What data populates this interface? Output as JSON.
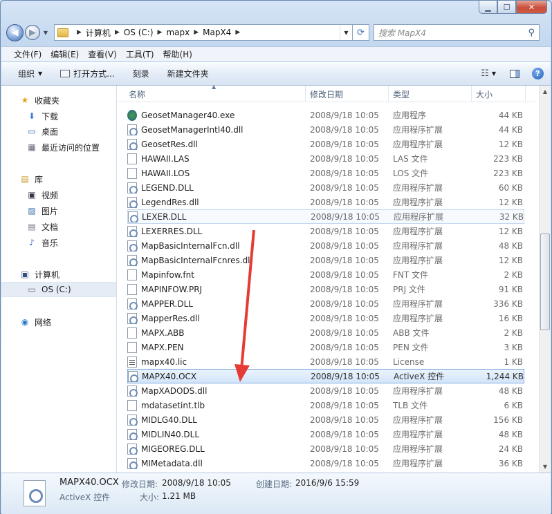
{
  "window": {
    "caption_buttons": {
      "minimize": "▁",
      "maximize": "☐",
      "close": "✕"
    }
  },
  "nav": {
    "back_icon": "back-arrow-icon",
    "forward_icon": "forward-arrow-icon",
    "breadcrumb": [
      "计算机",
      "OS (C:)",
      "mapx",
      "MapX4"
    ],
    "search_placeholder": "搜索 MapX4"
  },
  "menu": [
    "文件(F)",
    "编辑(E)",
    "查看(V)",
    "工具(T)",
    "帮助(H)"
  ],
  "toolbar": {
    "organize": "组织",
    "open_with": "打开方式...",
    "burn": "刻录",
    "new_folder": "新建文件夹"
  },
  "sidebar": [
    {
      "label": "收藏夹",
      "icon": "star-icon",
      "indent": 0
    },
    {
      "label": "下载",
      "icon": "download-folder-icon",
      "indent": 1
    },
    {
      "label": "桌面",
      "icon": "desktop-icon",
      "indent": 1
    },
    {
      "label": "最近访问的位置",
      "icon": "recent-places-icon",
      "indent": 1
    },
    {
      "label": "库",
      "icon": "library-icon",
      "indent": 0
    },
    {
      "label": "视频",
      "icon": "video-icon",
      "indent": 1
    },
    {
      "label": "图片",
      "icon": "pictures-icon",
      "indent": 1
    },
    {
      "label": "文档",
      "icon": "documents-icon",
      "indent": 1
    },
    {
      "label": "音乐",
      "icon": "music-icon",
      "indent": 1
    },
    {
      "label": "计算机",
      "icon": "computer-icon",
      "indent": 0
    },
    {
      "label": "OS (C:)",
      "icon": "drive-icon",
      "indent": 1,
      "selected": true
    },
    {
      "label": "网络",
      "icon": "network-icon",
      "indent": 0
    }
  ],
  "columns": {
    "name": "名称",
    "date": "修改日期",
    "type": "类型",
    "size": "大小"
  },
  "files": [
    {
      "name": "GeosetManager40.exe",
      "date": "2008/9/18 10:05",
      "type": "应用程序",
      "size": "44 KB",
      "icon": "exe"
    },
    {
      "name": "GeosetManagerIntl40.dll",
      "date": "2008/9/18 10:05",
      "type": "应用程序扩展",
      "size": "44 KB",
      "icon": "dll"
    },
    {
      "name": "GeosetRes.dll",
      "date": "2008/9/18 10:05",
      "type": "应用程序扩展",
      "size": "12 KB",
      "icon": "dll"
    },
    {
      "name": "HAWAII.LAS",
      "date": "2008/9/18 10:05",
      "type": "LAS 文件",
      "size": "223 KB",
      "icon": "blank"
    },
    {
      "name": "HAWAII.LOS",
      "date": "2008/9/18 10:05",
      "type": "LOS 文件",
      "size": "223 KB",
      "icon": "blank"
    },
    {
      "name": "LEGEND.DLL",
      "date": "2008/9/18 10:05",
      "type": "应用程序扩展",
      "size": "60 KB",
      "icon": "dll"
    },
    {
      "name": "LegendRes.dll",
      "date": "2008/9/18 10:05",
      "type": "应用程序扩展",
      "size": "12 KB",
      "icon": "dll"
    },
    {
      "name": "LEXER.DLL",
      "date": "2008/9/18 10:05",
      "type": "应用程序扩展",
      "size": "32 KB",
      "icon": "dll",
      "state": "hover"
    },
    {
      "name": "LEXERRES.DLL",
      "date": "2008/9/18 10:05",
      "type": "应用程序扩展",
      "size": "12 KB",
      "icon": "dll"
    },
    {
      "name": "MapBasicInternalFcn.dll",
      "date": "2008/9/18 10:05",
      "type": "应用程序扩展",
      "size": "48 KB",
      "icon": "dll"
    },
    {
      "name": "MapBasicInternalFcnres.dll",
      "date": "2008/9/18 10:05",
      "type": "应用程序扩展",
      "size": "12 KB",
      "icon": "dll"
    },
    {
      "name": "Mapinfow.fnt",
      "date": "2008/9/18 10:05",
      "type": "FNT 文件",
      "size": "2 KB",
      "icon": "blank"
    },
    {
      "name": "MAPINFOW.PRJ",
      "date": "2008/9/18 10:05",
      "type": "PRJ 文件",
      "size": "91 KB",
      "icon": "blank"
    },
    {
      "name": "MAPPER.DLL",
      "date": "2008/9/18 10:05",
      "type": "应用程序扩展",
      "size": "336 KB",
      "icon": "dll"
    },
    {
      "name": "MapperRes.dll",
      "date": "2008/9/18 10:05",
      "type": "应用程序扩展",
      "size": "16 KB",
      "icon": "dll"
    },
    {
      "name": "MAPX.ABB",
      "date": "2008/9/18 10:05",
      "type": "ABB 文件",
      "size": "2 KB",
      "icon": "blank"
    },
    {
      "name": "MAPX.PEN",
      "date": "2008/9/18 10:05",
      "type": "PEN 文件",
      "size": "3 KB",
      "icon": "blank"
    },
    {
      "name": "mapx40.lic",
      "date": "2008/9/18 10:05",
      "type": "License",
      "size": "1 KB",
      "icon": "doc"
    },
    {
      "name": "MAPX40.OCX",
      "date": "2008/9/18 10:05",
      "type": "ActiveX 控件",
      "size": "1,244 KB",
      "icon": "dll",
      "state": "selected"
    },
    {
      "name": "MapXADODS.dll",
      "date": "2008/9/18 10:05",
      "type": "应用程序扩展",
      "size": "48 KB",
      "icon": "dll"
    },
    {
      "name": "mdatasetint.tlb",
      "date": "2008/9/18 10:05",
      "type": "TLB 文件",
      "size": "6 KB",
      "icon": "blank"
    },
    {
      "name": "MIDLG40.DLL",
      "date": "2008/9/18 10:05",
      "type": "应用程序扩展",
      "size": "156 KB",
      "icon": "dll"
    },
    {
      "name": "MIDLIN40.DLL",
      "date": "2008/9/18 10:05",
      "type": "应用程序扩展",
      "size": "48 KB",
      "icon": "dll"
    },
    {
      "name": "MIGEOREG.DLL",
      "date": "2008/9/18 10:05",
      "type": "应用程序扩展",
      "size": "24 KB",
      "icon": "dll"
    },
    {
      "name": "MIMetadata.dll",
      "date": "2008/9/18 10:05",
      "type": "应用程序扩展",
      "size": "36 KB",
      "icon": "dll"
    }
  ],
  "details": {
    "name": "MAPX40.OCX",
    "type": "ActiveX 控件",
    "modified_label": "修改日期:",
    "modified_value": "2008/9/18 10:05",
    "created_label": "创建日期:",
    "created_value": "2016/9/6 15:59",
    "size_label": "大小:",
    "size_value": "1.21 MB"
  },
  "annotation": {
    "color": "#e53b35"
  }
}
